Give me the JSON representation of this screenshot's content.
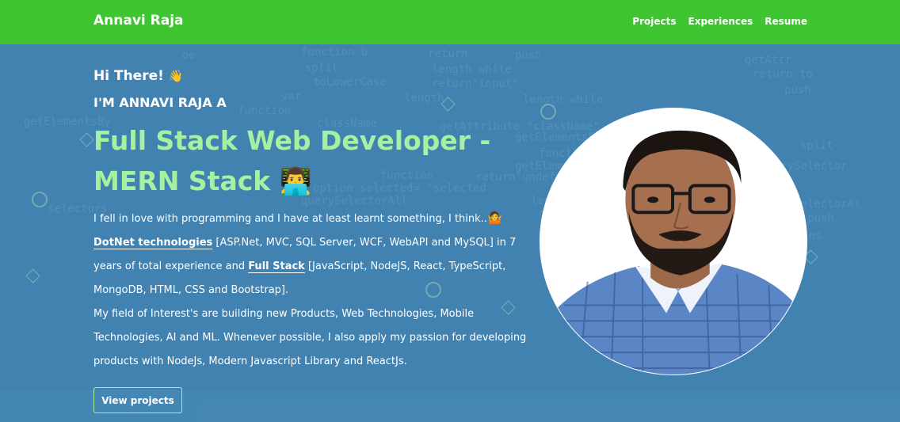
{
  "nav": {
    "brand": "Annavi Raja",
    "links": [
      "Projects",
      "Experiences",
      "Resume"
    ]
  },
  "hero": {
    "greeting": "Hi There!",
    "greeting_emoji": "👋",
    "intro": "I'M ANNAVI RAJA A",
    "role_line1": "Full Stack Web Developer -",
    "role_line2": "MERN Stack",
    "role_emoji": "👨‍💻",
    "bio": {
      "p1_start": "I fell in love with programming and I have at least learnt something, I think..",
      "p1_emoji": "🤷",
      "highlight1": "DotNet technologies",
      "p1_mid": " [ASP.Net, MVC, SQL Server, WCF, WebAPI and MySQL] in 7 years of total experience and ",
      "highlight2": "Full Stack",
      "p1_end": " [JavaScript, NodeJS, React, TypeScript, MongoDB, HTML, CSS and Bootstrap].",
      "p2": "My field of Interest's are building new Products, Web Technologies, Mobile Technologies, AI and ML. Whenever possible, I also apply my passion for developing products with NodeJs, Modern Javascript Library and ReactJs."
    },
    "button_label": "View projects"
  },
  "colors": {
    "navbar": "#3fc531",
    "background": "#4282b1",
    "accent": "#a6f0a2"
  }
}
